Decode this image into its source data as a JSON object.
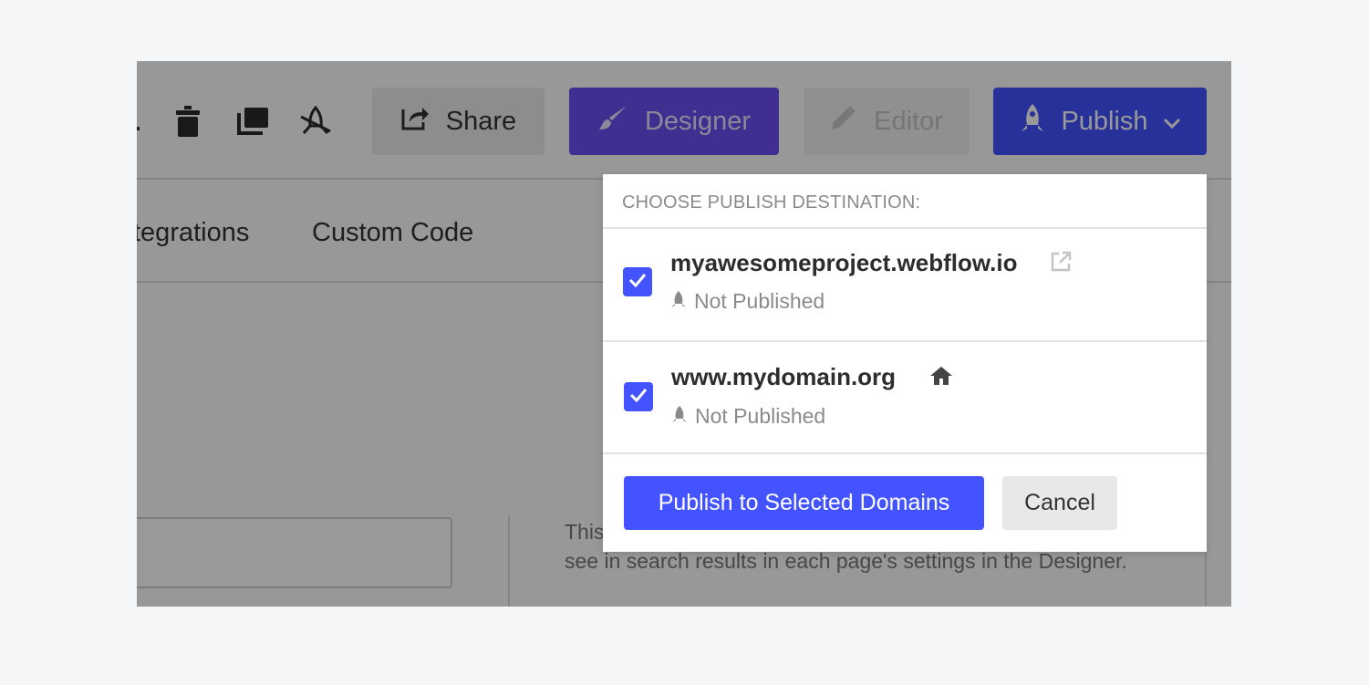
{
  "toolbar": {
    "share_label": "Share",
    "designer_label": "Designer",
    "editor_label": "Editor",
    "publish_label": "Publish"
  },
  "tabs": {
    "integrations_label": "tegrations",
    "custom_code_label": "Custom Code"
  },
  "help_text": "This                                                                          what visitors see in search results in each page's settings in the Designer.",
  "publish_menu": {
    "header": "CHOOSE PUBLISH DESTINATION:",
    "destinations": [
      {
        "domain": "myawesomeproject.webflow.io",
        "status": "Not Published",
        "checked": true,
        "icon": "external-link-icon"
      },
      {
        "domain": "www.mydomain.org",
        "status": "Not Published",
        "checked": true,
        "icon": "home-icon"
      }
    ],
    "publish_button": "Publish to Selected Domains",
    "cancel_button": "Cancel"
  },
  "colors": {
    "accent": "#4353ff",
    "designer": "#6b4ef0",
    "page_background": "#f5f6f8"
  }
}
